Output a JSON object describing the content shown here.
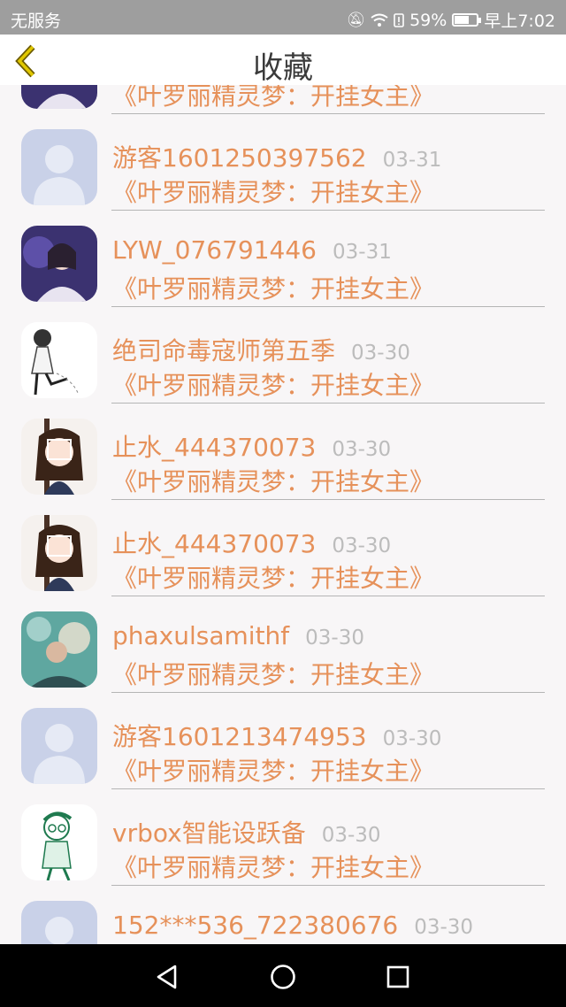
{
  "status_bar": {
    "carrier": "无服务",
    "battery_percent": "59%",
    "time": "早上7:02",
    "battery_level": 0.59,
    "icons": [
      "mute-icon",
      "wifi-icon",
      "alert-icon",
      "battery-icon"
    ]
  },
  "header": {
    "title": "收藏",
    "back_icon": "chevron-left-icon"
  },
  "colors": {
    "accent": "#e6915a",
    "date": "#bcbcbc",
    "title": "#3a3a3a"
  },
  "items": [
    {
      "name": "",
      "date": "",
      "book": "《叶罗丽精灵梦：开挂女主》",
      "avatar": "photo"
    },
    {
      "name": "游客1601250397562",
      "date": "03-31",
      "book": "《叶罗丽精灵梦：开挂女主》",
      "avatar": "default"
    },
    {
      "name": "LYW_076791446",
      "date": "03-31",
      "book": "《叶罗丽精灵梦：开挂女主》",
      "avatar": "photo"
    },
    {
      "name": "绝司命毒寇师第五季",
      "date": "03-30",
      "book": "《叶罗丽精灵梦：开挂女主》",
      "avatar": "sketch"
    },
    {
      "name": "止水_444370073",
      "date": "03-30",
      "book": "《叶罗丽精灵梦：开挂女主》",
      "avatar": "anime"
    },
    {
      "name": "止水_444370073",
      "date": "03-30",
      "book": "《叶罗丽精灵梦：开挂女主》",
      "avatar": "anime"
    },
    {
      "name": "phaxulsamithf",
      "date": "03-30",
      "book": "《叶罗丽精灵梦：开挂女主》",
      "avatar": "underwater"
    },
    {
      "name": "游客1601213474953",
      "date": "03-30",
      "book": "《叶罗丽精灵梦：开挂女主》",
      "avatar": "default"
    },
    {
      "name": "vrbox智能设跃备",
      "date": "03-30",
      "book": "《叶罗丽精灵梦：开挂女主》",
      "avatar": "sketch-green"
    },
    {
      "name": "152***536_722380676",
      "date": "03-30",
      "book": "",
      "avatar": "default"
    }
  ],
  "nav_bar": {
    "back": "triangle-back-icon",
    "home": "circle-home-icon",
    "recents": "square-recents-icon"
  }
}
